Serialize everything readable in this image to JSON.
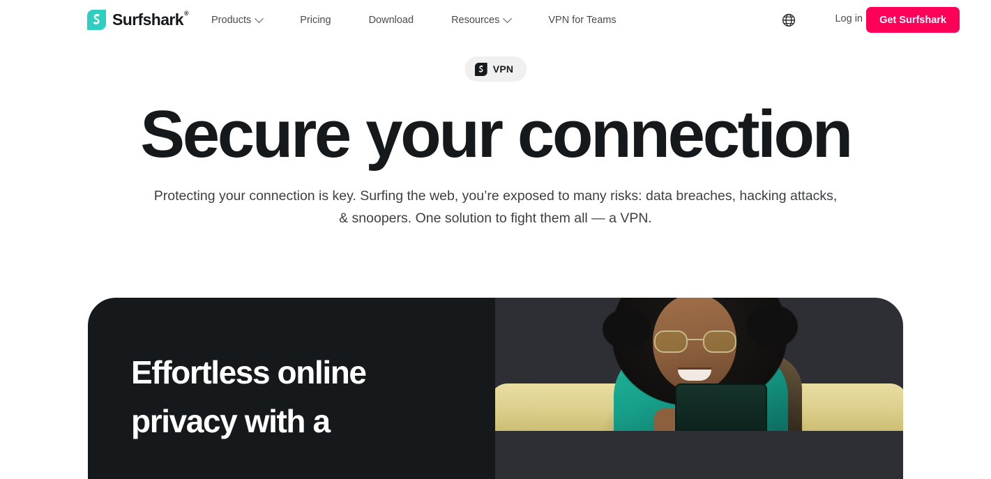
{
  "header": {
    "brand": {
      "name": "Surfshark",
      "trademark": "®",
      "logo_icon": "surfshark-logo-icon",
      "logo_color": "#2ecfc0"
    },
    "nav": [
      {
        "label": "Products",
        "has_dropdown": true
      },
      {
        "label": "Pricing",
        "has_dropdown": false
      },
      {
        "label": "Download",
        "has_dropdown": false
      },
      {
        "label": "Resources",
        "has_dropdown": true
      },
      {
        "label": "VPN for Teams",
        "has_dropdown": false
      }
    ],
    "language_icon": "globe-icon",
    "login_label": "Log in",
    "cta_label": "Get Surfshark",
    "cta_color": "#ff0059"
  },
  "hero": {
    "badge": {
      "label": "VPN",
      "icon": "surfshark-mark-icon",
      "background": "#f0f0f1"
    },
    "headline": "Secure your connection",
    "subhead": "Protecting your connection is key. Surfing the web, you’re exposed to many risks: data breaches, hacking attacks, & snoopers. One solution to fight them all — a VPN."
  },
  "feature_card": {
    "title": "Effortless online privacy with a",
    "left_background": "#16191c",
    "right_background": "#2e2f35",
    "image_alt": "woman-with-tablet-photo"
  }
}
